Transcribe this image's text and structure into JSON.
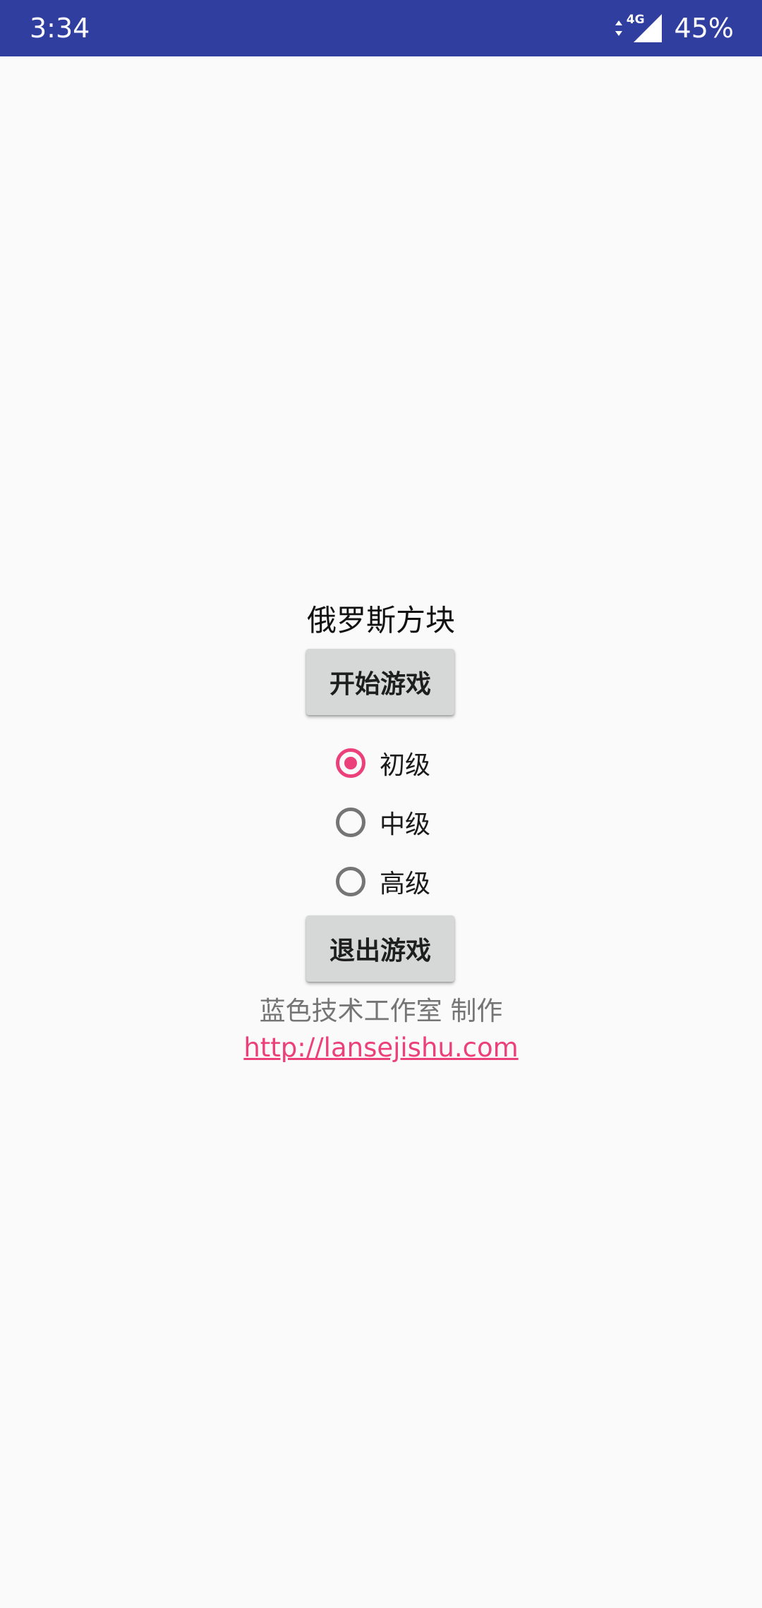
{
  "status_bar": {
    "time": "3:34",
    "network_type": "4G",
    "battery": "45%",
    "icons": [
      "data-activity-icon",
      "signal-icon"
    ],
    "background_color": "#303f9f"
  },
  "app": {
    "title": "俄罗斯方块",
    "start_button_label": "开始游戏",
    "difficulty_options": [
      {
        "label": "初级",
        "selected": true
      },
      {
        "label": "中级",
        "selected": false
      },
      {
        "label": "高级",
        "selected": false
      }
    ],
    "exit_button_label": "退出游戏",
    "credit_text": "蓝色技术工作室 制作",
    "link_text": "http://lansejishu.com",
    "accent_color": "#ec407a"
  }
}
